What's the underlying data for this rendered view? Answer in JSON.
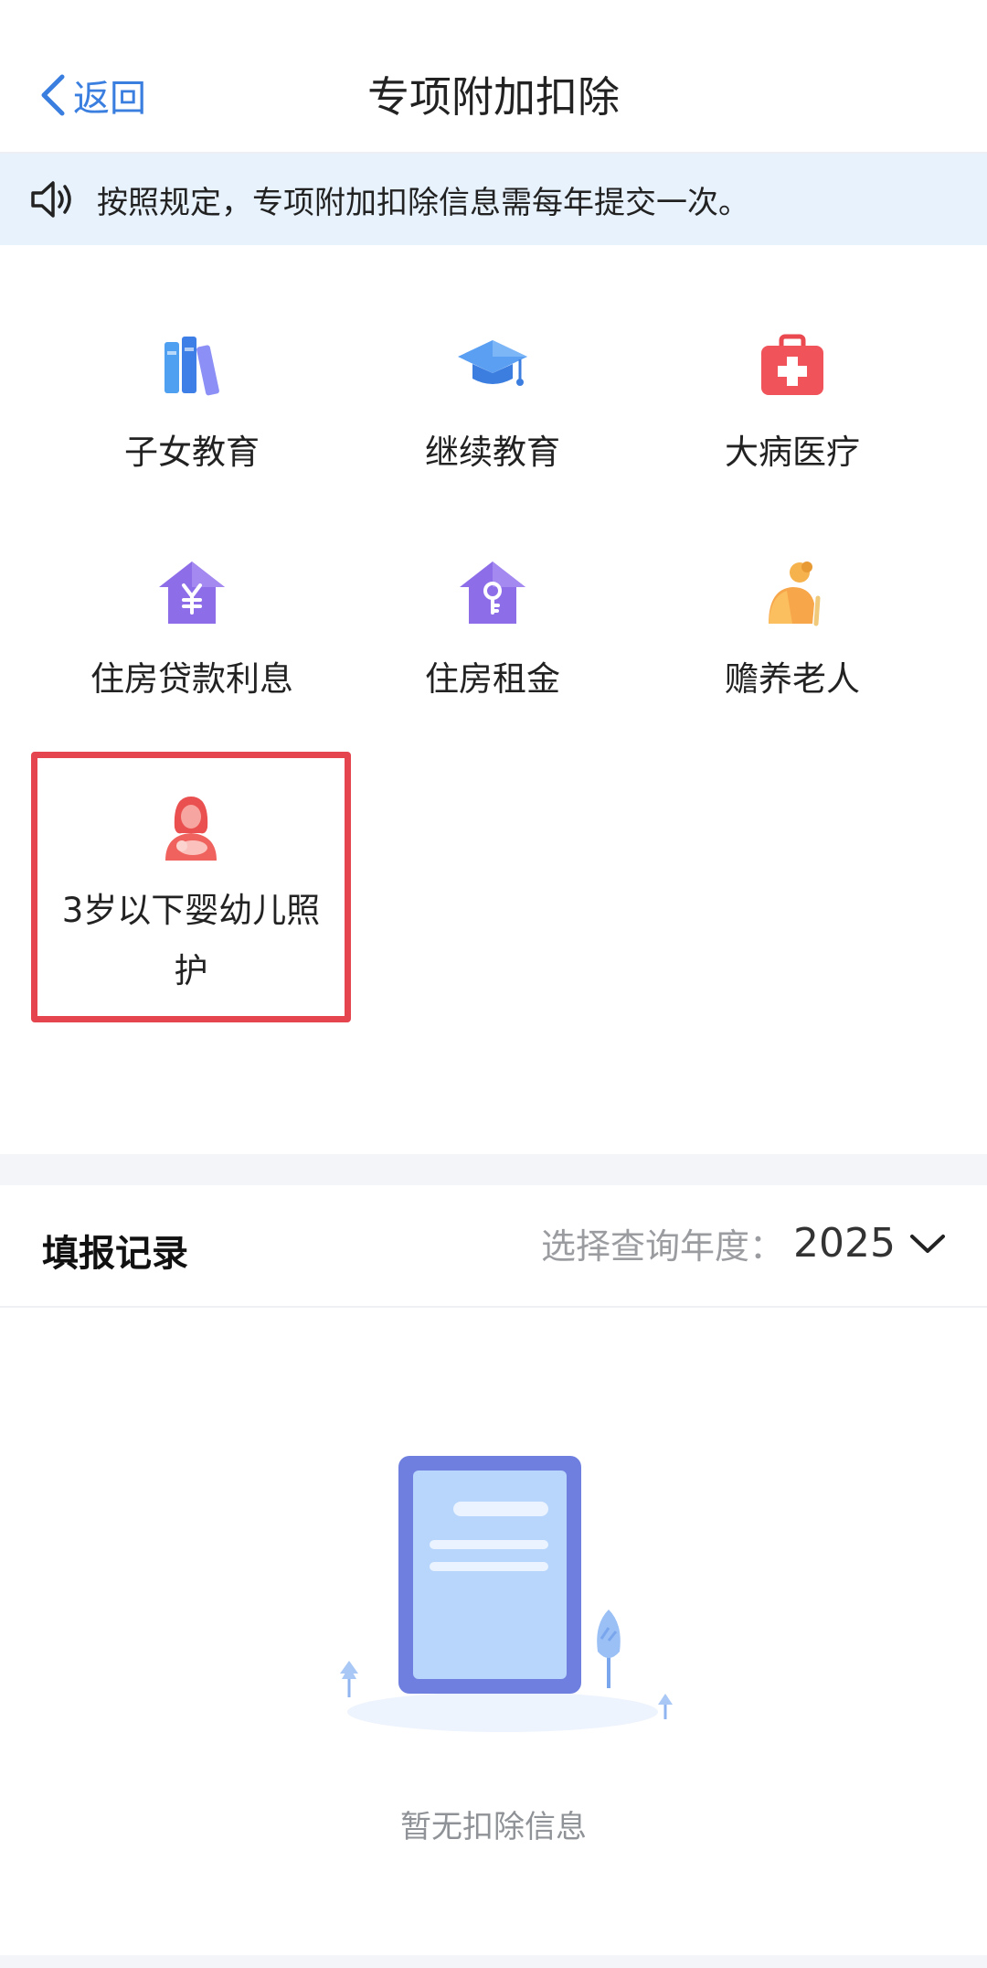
{
  "nav": {
    "back_label": "返回",
    "title": "专项附加扣除"
  },
  "notice": {
    "text": "按照规定，专项附加扣除信息需每年提交一次。"
  },
  "items": [
    {
      "label": "子女教育",
      "icon": "books-icon"
    },
    {
      "label": "继续教育",
      "icon": "graduation-cap-icon"
    },
    {
      "label": "大病医疗",
      "icon": "medical-kit-icon"
    },
    {
      "label": "住房贷款利息",
      "icon": "house-yuan-icon"
    },
    {
      "label": "住房租金",
      "icon": "house-key-icon"
    },
    {
      "label": "赡养老人",
      "icon": "elderly-person-icon"
    },
    {
      "label": "3岁以下婴幼儿照护",
      "icon": "mother-baby-icon"
    }
  ],
  "records": {
    "title": "填报记录",
    "year_label": "选择查询年度：",
    "year_value": "2025"
  },
  "empty": {
    "text": "暂无扣除信息"
  },
  "colors": {
    "accent": "#3a7fe0",
    "notice_bg": "#e8f2fd",
    "highlight_border": "#e5454f"
  }
}
